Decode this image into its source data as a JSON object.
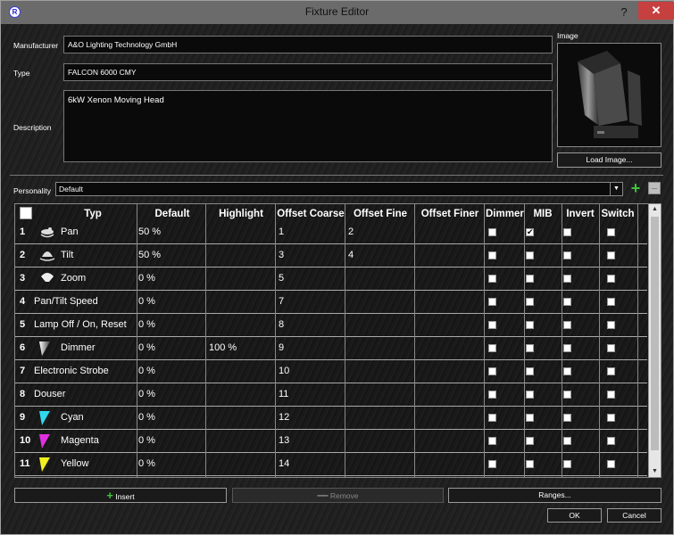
{
  "window": {
    "title": "Fixture Editor",
    "help": "?",
    "close": "✕"
  },
  "form": {
    "manufacturer_label": "Manufacturer",
    "manufacturer_value": "A&O Lighting Technology GmbH",
    "type_label": "Type",
    "type_value": "FALCON 6000 CMY",
    "description_label": "Description",
    "description_value": "6kW Xenon Moving Head",
    "image_label": "Image",
    "load_image_label": "Load Image...",
    "personality_label": "Personality",
    "personality_value": "Default"
  },
  "table": {
    "headers": [
      "Typ",
      "Default",
      "Highlight",
      "Offset Coarse",
      "Offset Fine",
      "Offset Finer",
      "Dimmer",
      "MIB",
      "Invert",
      "Switch"
    ],
    "rows": [
      {
        "num": "1",
        "icon": "pan-icon",
        "typ": "Pan",
        "default": "50 %",
        "highlight": "",
        "coarse": "1",
        "fine": "2",
        "finer": "",
        "dimmer": false,
        "mib": true,
        "invert": false,
        "switch": false
      },
      {
        "num": "2",
        "icon": "tilt-icon",
        "typ": "Tilt",
        "default": "50 %",
        "highlight": "",
        "coarse": "3",
        "fine": "4",
        "finer": "",
        "dimmer": false,
        "mib": false,
        "invert": false,
        "switch": false
      },
      {
        "num": "3",
        "icon": "zoom-icon",
        "typ": "Zoom",
        "default": "0 %",
        "highlight": "",
        "coarse": "5",
        "fine": "",
        "finer": "",
        "dimmer": false,
        "mib": false,
        "invert": false,
        "switch": false
      },
      {
        "num": "4",
        "icon": "",
        "typ": "Pan/Tilt Speed",
        "default": "0 %",
        "highlight": "",
        "coarse": "7",
        "fine": "",
        "finer": "",
        "dimmer": false,
        "mib": false,
        "invert": false,
        "switch": false
      },
      {
        "num": "5",
        "icon": "",
        "typ": "Lamp Off / On, Reset",
        "default": "0 %",
        "highlight": "",
        "coarse": "8",
        "fine": "",
        "finer": "",
        "dimmer": false,
        "mib": false,
        "invert": false,
        "switch": false
      },
      {
        "num": "6",
        "icon": "dimmer-icon",
        "typ": "Dimmer",
        "default": "0 %",
        "highlight": "100 %",
        "coarse": "9",
        "fine": "",
        "finer": "",
        "dimmer": false,
        "mib": false,
        "invert": false,
        "switch": false
      },
      {
        "num": "7",
        "icon": "",
        "typ": "Electronic Strobe",
        "default": "0 %",
        "highlight": "",
        "coarse": "10",
        "fine": "",
        "finer": "",
        "dimmer": false,
        "mib": false,
        "invert": false,
        "switch": false
      },
      {
        "num": "8",
        "icon": "",
        "typ": "Douser",
        "default": "0 %",
        "highlight": "",
        "coarse": "11",
        "fine": "",
        "finer": "",
        "dimmer": false,
        "mib": false,
        "invert": false,
        "switch": false
      },
      {
        "num": "9",
        "icon": "cyan-icon",
        "typ": "Cyan",
        "default": "0 %",
        "highlight": "",
        "coarse": "12",
        "fine": "",
        "finer": "",
        "dimmer": false,
        "mib": false,
        "invert": false,
        "switch": false
      },
      {
        "num": "10",
        "icon": "magenta-icon",
        "typ": "Magenta",
        "default": "0 %",
        "highlight": "",
        "coarse": "13",
        "fine": "",
        "finer": "",
        "dimmer": false,
        "mib": false,
        "invert": false,
        "switch": false
      },
      {
        "num": "11",
        "icon": "yellow-icon",
        "typ": "Yellow",
        "default": "0 %",
        "highlight": "",
        "coarse": "14",
        "fine": "",
        "finer": "",
        "dimmer": false,
        "mib": false,
        "invert": false,
        "switch": false
      }
    ]
  },
  "buttons": {
    "insert": "Insert",
    "remove": "Remove",
    "ranges": "Ranges...",
    "ok": "OK",
    "cancel": "Cancel"
  },
  "colors": {
    "cyan": "#30d8f0",
    "magenta": "#e030e0",
    "yellow": "#f0f020",
    "add_green": "#3ec43e"
  }
}
